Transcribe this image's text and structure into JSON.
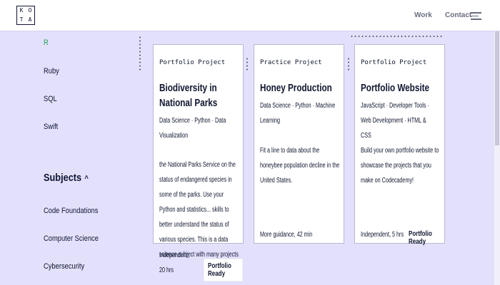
{
  "header": {
    "logo_letters": [
      "K",
      "O",
      "T",
      "A"
    ],
    "nav": [
      {
        "label": "Work"
      },
      {
        "label": "Contact"
      }
    ],
    "menu_icon": "hamburger-icon"
  },
  "sidebar": {
    "languages": [
      "R",
      "Ruby",
      "SQL",
      "Swift"
    ],
    "subjects_heading": "Subjects",
    "subjects_chevron": "^",
    "subjects": [
      "Code Foundations",
      "Computer Science",
      "Cybersecurity"
    ]
  },
  "cards": [
    {
      "type": "Portfolio Project",
      "title": "Biodiversity in National Parks",
      "tags": "Data Science · Python · Data Visualization",
      "description": "the National Parks Service on the status of endangered species in some of the parks. Use your Python and statistics... skills to better understand the status of various species. This is a data science subject with many projects",
      "meta": "Independent, 20 hrs",
      "badge": "Portfolio Ready"
    },
    {
      "type": "Practice Project",
      "title": "Honey Production",
      "tags": "Data Science · Python · Machine Learning",
      "description": "Fit a line to data about the honeybee population decline in the United States.",
      "meta": "More guidance, 42 min",
      "badge": ""
    },
    {
      "type": "Portfolio Project",
      "title": "Portfolio Website",
      "tags": "JavaScript · Developer Tools · Web Development · HTML & CSS",
      "description": "Build your own portfolio website to showcase the projects that you make on Codecademy!",
      "meta": "Independent, 5 hrs",
      "badge": "Portfolio Ready"
    }
  ],
  "colors": {
    "page_bg": "#e3e0fb",
    "accent_green": "#20a35a",
    "navy": "#10162f"
  }
}
